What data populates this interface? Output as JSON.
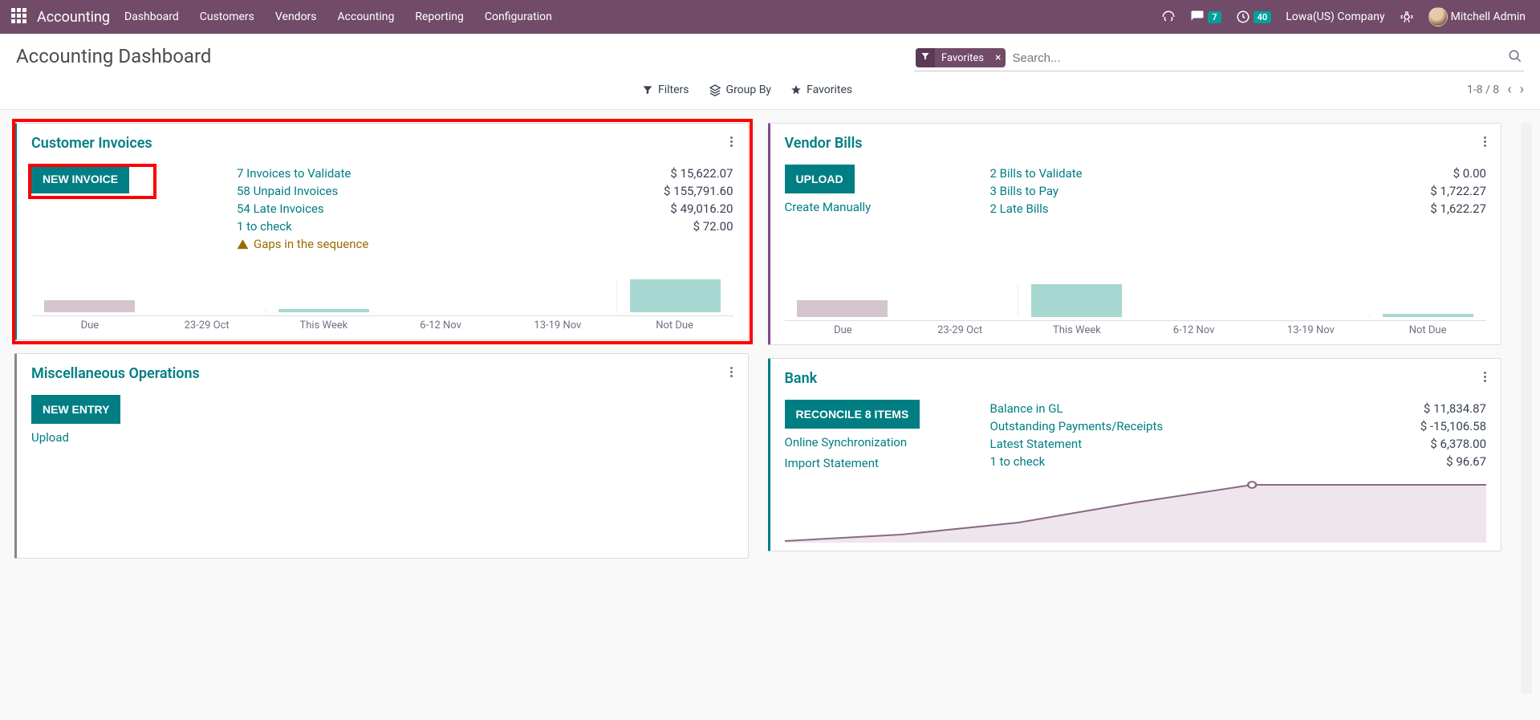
{
  "topbar": {
    "app_name": "Accounting",
    "nav": [
      "Dashboard",
      "Customers",
      "Vendors",
      "Accounting",
      "Reporting",
      "Configuration"
    ],
    "messages_count": "7",
    "activities_count": "40",
    "company": "Lowa(US) Company",
    "user": "Mitchell Admin"
  },
  "header": {
    "title": "Accounting Dashboard",
    "search_facet": "Favorites",
    "search_placeholder": "Search...",
    "filters_label": "Filters",
    "groupby_label": "Group By",
    "favorites_label": "Favorites",
    "pager": "1-8 / 8"
  },
  "cards": {
    "customer_invoices": {
      "title": "Customer Invoices",
      "button": "NEW INVOICE",
      "rows": [
        {
          "label": "7 Invoices to Validate",
          "value": "$ 15,622.07"
        },
        {
          "label": "58 Unpaid Invoices",
          "value": "$ 155,791.60"
        },
        {
          "label": "54 Late Invoices",
          "value": "$ 49,016.20"
        },
        {
          "label": "1 to check",
          "value": "$ 72.00"
        }
      ],
      "warning": "Gaps in the sequence"
    },
    "vendor_bills": {
      "title": "Vendor Bills",
      "button": "UPLOAD",
      "link": "Create Manually",
      "rows": [
        {
          "label": "2 Bills to Validate",
          "value": "$ 0.00"
        },
        {
          "label": "3 Bills to Pay",
          "value": "$ 1,722.27"
        },
        {
          "label": "2 Late Bills",
          "value": "$ 1,622.27"
        }
      ]
    },
    "misc": {
      "title": "Miscellaneous Operations",
      "button": "NEW ENTRY",
      "link": "Upload"
    },
    "bank": {
      "title": "Bank",
      "button": "RECONCILE 8 ITEMS",
      "link1": "Online Synchronization",
      "link2": "Import Statement",
      "rows": [
        {
          "label": "Balance in GL",
          "value": "$ 11,834.87"
        },
        {
          "label": "Outstanding Payments/Receipts",
          "value": "$ -15,106.58"
        },
        {
          "label": "Latest Statement",
          "value": "$ 6,378.00"
        },
        {
          "label": "1 to check",
          "value": "$ 96.67"
        }
      ]
    }
  },
  "chart_data": [
    {
      "type": "bar",
      "chart_for": "customer_invoices",
      "categories": [
        "Due",
        "23-29 Oct",
        "This Week",
        "6-12 Nov",
        "13-19 Nov",
        "Not Due"
      ],
      "series": [
        {
          "name": "past",
          "color": "#d5c5cf",
          "values": [
            16,
            0,
            0,
            0,
            0,
            0
          ]
        },
        {
          "name": "future",
          "color": "#a7d7d1",
          "values": [
            0,
            0,
            4,
            0,
            0,
            42
          ]
        }
      ],
      "ylim": [
        0,
        60
      ]
    },
    {
      "type": "bar",
      "chart_for": "vendor_bills",
      "categories": [
        "Due",
        "23-29 Oct",
        "This Week",
        "6-12 Nov",
        "13-19 Nov",
        "Not Due"
      ],
      "series": [
        {
          "name": "past",
          "color": "#d5c5cf",
          "values": [
            22,
            0,
            0,
            0,
            0,
            0
          ]
        },
        {
          "name": "future",
          "color": "#a7d7d1",
          "values": [
            0,
            0,
            42,
            0,
            0,
            4
          ]
        }
      ],
      "ylim": [
        0,
        60
      ]
    },
    {
      "type": "line",
      "chart_for": "bank",
      "x": [
        0,
        1,
        2,
        3,
        4,
        5,
        6
      ],
      "y": [
        0,
        0.5,
        1.5,
        3.0,
        4.5,
        4.5,
        4.5
      ],
      "ylim": [
        0,
        5
      ]
    }
  ]
}
